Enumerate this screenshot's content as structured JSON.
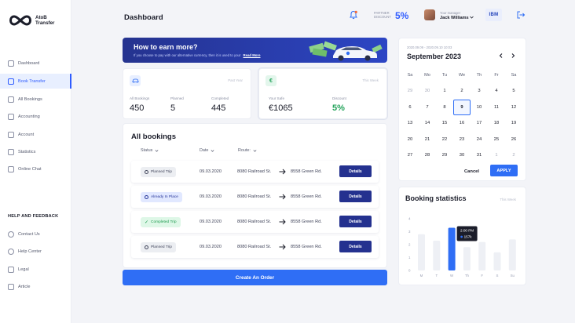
{
  "brand": {
    "name_line1": "AtoB",
    "name_line2": "Transfer"
  },
  "sidebar": {
    "items": [
      {
        "label": "Dashboard"
      },
      {
        "label": "Book Transfer"
      },
      {
        "label": "All Bookings"
      },
      {
        "label": "Accounting"
      },
      {
        "label": "Account"
      },
      {
        "label": "Statistics"
      },
      {
        "label": "Online Chat"
      }
    ],
    "help_heading": "HELP AND FEEDBACK",
    "help_items": [
      {
        "label": "Contact Us"
      },
      {
        "label": "Help Center"
      },
      {
        "label": "Legal"
      },
      {
        "label": "Article"
      }
    ]
  },
  "header": {
    "title": "Dashboard",
    "partner_label_1": "PARTNER",
    "partner_label_2": "DISCOUNT",
    "partner_value": "5%",
    "user_role": "Your manager",
    "user_name": "Jack Williams",
    "company": "IBM"
  },
  "banner": {
    "title": "How to earn more?",
    "subtitle": "If you choose to pay with our alternative currency, then it is used to your",
    "link": "Read More"
  },
  "stats": {
    "tag": "Past Year",
    "labels": [
      "All Bookings",
      "Planned",
      "Completed"
    ],
    "values": [
      "450",
      "5",
      "445"
    ]
  },
  "discount_card": {
    "tag": "This Week",
    "safe_label": "Your Safe",
    "safe_value": "€1065",
    "discount_label": "Discount",
    "discount_value": "5%"
  },
  "bookings": {
    "title": "All bookings",
    "columns": [
      "Status",
      "Date",
      "Route:"
    ],
    "rows": [
      {
        "status": "Planned Trip",
        "date": "09.03.2020",
        "from": "8080 Railroad St.",
        "to": "8558 Green Rd."
      },
      {
        "status": "Already In Place",
        "date": "09.03.2020",
        "from": "8080 Railroad St.",
        "to": "8558 Green Rd."
      },
      {
        "status": "Completed Trip",
        "date": "09.03.2020",
        "from": "8080 Railroad St.",
        "to": "8558 Green Rd."
      },
      {
        "status": "Planned Trip",
        "date": "09.03.2020",
        "from": "8080 Railroad St.",
        "to": "8558 Green Rd."
      }
    ],
    "details_label": "Details",
    "create_label": "Create An Order"
  },
  "calendar": {
    "range": "2020.09.09 - 2020.09.10 10:03",
    "month": "September 2023",
    "weekdays": [
      "Sa",
      "Mo",
      "Tu",
      "We",
      "Th",
      "Fr",
      "Sa"
    ],
    "weeks": [
      [
        "29",
        "30",
        "1",
        "2",
        "3",
        "4",
        "5"
      ],
      [
        "6",
        "7",
        "8",
        "9",
        "10",
        "11",
        "12"
      ],
      [
        "13",
        "14",
        "15",
        "16",
        "17",
        "18",
        "19"
      ],
      [
        "20",
        "21",
        "22",
        "23",
        "24",
        "25",
        "26"
      ],
      [
        "27",
        "28",
        "29",
        "30",
        "31",
        "1",
        "2"
      ]
    ],
    "selected": "9",
    "cancel_label": "Cancel",
    "apply_label": "APPLY"
  },
  "booking_stats": {
    "title": "Booking statistics",
    "tag": "This Week",
    "tooltip_time": "2:00 PM",
    "tooltip_value": "157k"
  },
  "chart_data": {
    "type": "bar",
    "categories": [
      "M",
      "T",
      "W",
      "Th",
      "F",
      "S",
      "Su"
    ],
    "values": [
      2.8,
      2.3,
      3.3,
      1.8,
      2.2,
      1.4,
      2.4
    ],
    "highlight_index": 2,
    "yticks": [
      "0",
      "1",
      "2",
      "3",
      "4"
    ],
    "ylim": [
      0,
      4
    ],
    "colors": {
      "bar": "#eef0f5",
      "highlight": "#2f6ef5",
      "tooltip": "#1b1d2a"
    }
  }
}
